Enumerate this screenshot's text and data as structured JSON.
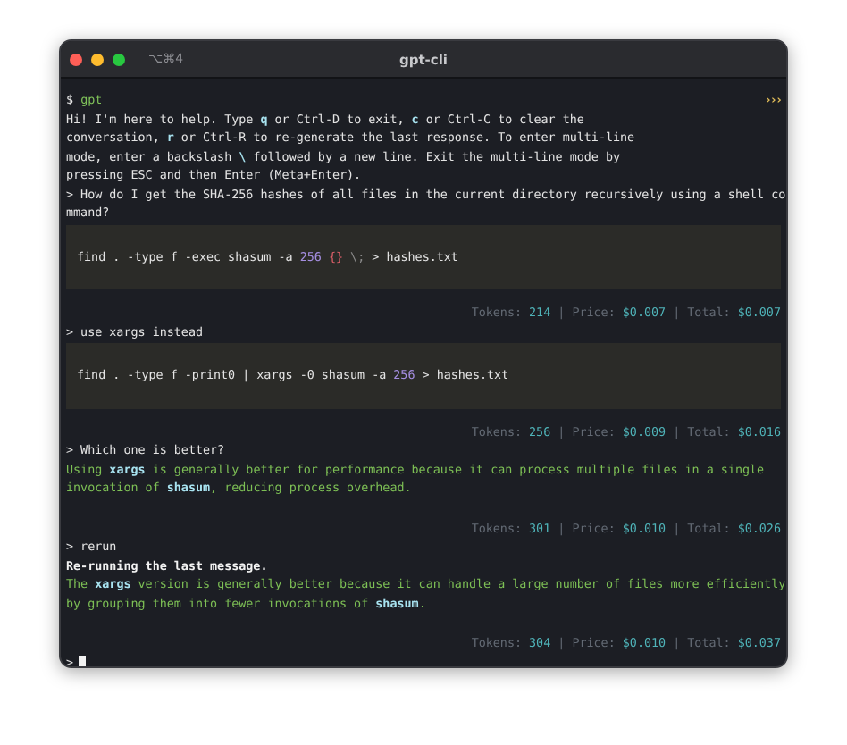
{
  "window": {
    "title": "gpt-cli",
    "shortcut": "⌥⌘4"
  },
  "rows": [
    {
      "kind": "shell",
      "segments": [
        {
          "kind": "plain",
          "text": "$ "
        },
        {
          "kind": "command",
          "text": "gpt"
        }
      ],
      "indicator": "›››"
    },
    {
      "kind": "text",
      "segments": [
        {
          "kind": "plain",
          "text": "Hi! I'm here to help. Type "
        },
        {
          "kind": "hl",
          "text": "q"
        },
        {
          "kind": "plain",
          "text": " or Ctrl-D to exit, "
        },
        {
          "kind": "hl",
          "text": "c"
        },
        {
          "kind": "plain",
          "text": " or Ctrl-C to clear the"
        }
      ]
    },
    {
      "kind": "text",
      "segments": [
        {
          "kind": "plain",
          "text": "conversation, "
        },
        {
          "kind": "hl",
          "text": "r"
        },
        {
          "kind": "plain",
          "text": " or Ctrl-R to re-generate the last response. To enter multi-line"
        }
      ]
    },
    {
      "kind": "text",
      "segments": [
        {
          "kind": "plain",
          "text": "mode, enter a backslash "
        },
        {
          "kind": "hl",
          "text": "\\"
        },
        {
          "kind": "plain",
          "text": " followed by a new line. Exit the multi-line mode by"
        }
      ]
    },
    {
      "kind": "text",
      "segments": [
        {
          "kind": "plain",
          "text": "pressing ESC and then Enter (Meta+Enter)."
        }
      ]
    },
    {
      "kind": "text",
      "segments": [
        {
          "kind": "plain",
          "text": "> How do I get the SHA-256 hashes of all files in the current directory recursively using a shell co"
        }
      ]
    },
    {
      "kind": "text",
      "segments": [
        {
          "kind": "plain",
          "text": "mmand?"
        }
      ]
    },
    {
      "kind": "code",
      "segments": [
        {
          "kind": "plain",
          "text": "find . -type f -exec shasum -a "
        },
        {
          "kind": "number",
          "text": "256"
        },
        {
          "kind": "punct",
          "text": " {}"
        },
        {
          "kind": "dim",
          "text": " \\;"
        },
        {
          "kind": "plain",
          "text": " > hashes.txt"
        }
      ]
    },
    {
      "kind": "stats",
      "segments": [
        {
          "kind": "label",
          "text": "Tokens: "
        },
        {
          "kind": "value",
          "text": "214"
        },
        {
          "kind": "label",
          "text": " | Price: "
        },
        {
          "kind": "value",
          "text": "$0.007"
        },
        {
          "kind": "label",
          "text": " | Total: "
        },
        {
          "kind": "value",
          "text": "$0.007"
        }
      ]
    },
    {
      "kind": "text",
      "segments": [
        {
          "kind": "plain",
          "text": "> use xargs instead"
        }
      ]
    },
    {
      "kind": "code",
      "segments": [
        {
          "kind": "plain",
          "text": "find . -type f -print0 | xargs -0 shasum -a "
        },
        {
          "kind": "number",
          "text": "256"
        },
        {
          "kind": "plain",
          "text": " > hashes.txt"
        }
      ]
    },
    {
      "kind": "stats",
      "segments": [
        {
          "kind": "label",
          "text": "Tokens: "
        },
        {
          "kind": "value",
          "text": "256"
        },
        {
          "kind": "label",
          "text": " | Price: "
        },
        {
          "kind": "value",
          "text": "$0.009"
        },
        {
          "kind": "label",
          "text": " | Total: "
        },
        {
          "kind": "value",
          "text": "$0.016"
        }
      ]
    },
    {
      "kind": "text",
      "segments": [
        {
          "kind": "plain",
          "text": "> Which one is better?"
        }
      ]
    },
    {
      "kind": "answer",
      "segments": [
        {
          "kind": "answer",
          "text": "Using "
        },
        {
          "kind": "hl",
          "text": "xargs"
        },
        {
          "kind": "answer",
          "text": " is generally better for performance because it can process multiple files in a single"
        }
      ]
    },
    {
      "kind": "answer",
      "segments": [
        {
          "kind": "answer",
          "text": "invocation of "
        },
        {
          "kind": "hl",
          "text": "shasum"
        },
        {
          "kind": "answer",
          "text": ", reducing process overhead."
        }
      ]
    },
    {
      "kind": "stats",
      "segments": [
        {
          "kind": "label",
          "text": "Tokens: "
        },
        {
          "kind": "value",
          "text": "301"
        },
        {
          "kind": "label",
          "text": " | Price: "
        },
        {
          "kind": "value",
          "text": "$0.010"
        },
        {
          "kind": "label",
          "text": " | Total: "
        },
        {
          "kind": "value",
          "text": "$0.026"
        }
      ]
    },
    {
      "kind": "text",
      "segments": [
        {
          "kind": "plain",
          "text": "> rerun"
        }
      ]
    },
    {
      "kind": "notice",
      "segments": [
        {
          "kind": "plain",
          "text": "Re-running the last message."
        }
      ]
    },
    {
      "kind": "answer",
      "segments": [
        {
          "kind": "answer",
          "text": "The "
        },
        {
          "kind": "hl",
          "text": "xargs"
        },
        {
          "kind": "answer",
          "text": " version is generally better because it can handle a large number of files more efficiently"
        }
      ]
    },
    {
      "kind": "answer",
      "segments": [
        {
          "kind": "answer",
          "text": "by grouping them into fewer invocations of "
        },
        {
          "kind": "hl",
          "text": "shasum"
        },
        {
          "kind": "answer",
          "text": "."
        }
      ]
    },
    {
      "kind": "stats",
      "segments": [
        {
          "kind": "label",
          "text": "Tokens: "
        },
        {
          "kind": "value",
          "text": "304"
        },
        {
          "kind": "label",
          "text": " | Price: "
        },
        {
          "kind": "value",
          "text": "$0.010"
        },
        {
          "kind": "label",
          "text": " | Total: "
        },
        {
          "kind": "value",
          "text": "$0.037"
        }
      ]
    },
    {
      "kind": "input",
      "segments": [
        {
          "kind": "plain",
          "text": ">"
        }
      ]
    }
  ]
}
